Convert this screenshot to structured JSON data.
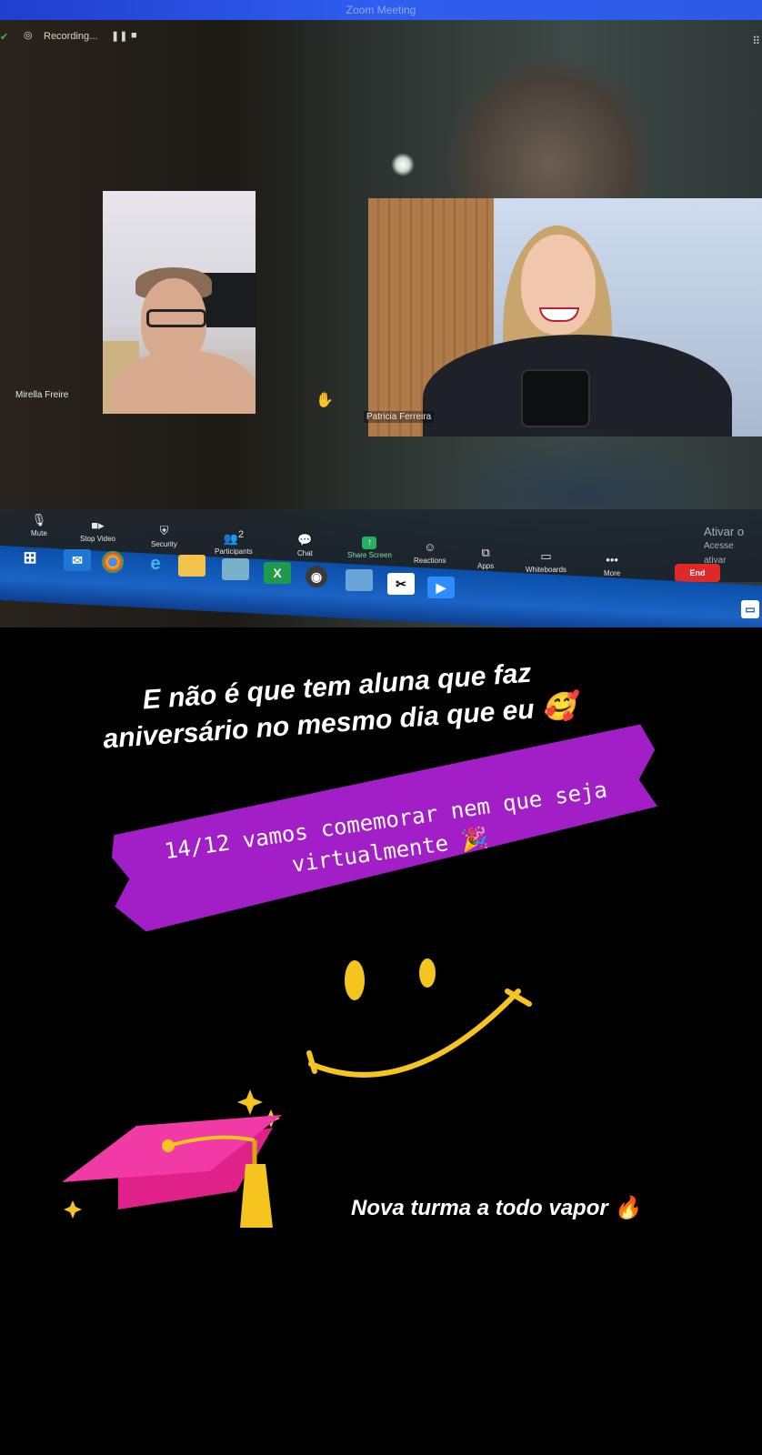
{
  "window": {
    "title": "Zoom Meeting"
  },
  "recording": {
    "status": "Recording...",
    "pause_symbol": "❚❚",
    "stop_symbol": "■"
  },
  "participants": [
    {
      "name": "Mirella Freire"
    },
    {
      "name": "Patricia Ferreira"
    }
  ],
  "toolbar": {
    "mute": "Mute",
    "stop_video": "Stop Video",
    "security": "Security",
    "participants": "Participants",
    "participants_count": "2",
    "chat": "Chat",
    "share_screen": "Share Screen",
    "reactions": "Reactions",
    "apps": "Apps",
    "whiteboards": "Whiteboards",
    "more": "More",
    "end": "End"
  },
  "watermark": {
    "line1": "Ativar o",
    "line2": "Acesse",
    "line3": "ativar"
  },
  "story": {
    "caption1_line1": "E não é que tem aluna que faz",
    "caption1_line2": "aniversário no mesmo dia que eu 🥰",
    "caption2_line1": "14/12 vamos comemorar nem que seja",
    "caption2_line2": "virtualmente 🎉",
    "caption3": "Nova turma a todo vapor 🔥"
  },
  "colors": {
    "zoom_blue": "#2d8cff",
    "end_red": "#e02828",
    "brush_purple": "#a21ec7",
    "cap_pink": "#f13aa6",
    "smiley_yellow": "#f5c41f"
  },
  "icons": [
    "microphone-icon",
    "video-camera-icon",
    "shield-icon",
    "participants-icon",
    "chat-icon",
    "share-screen-icon",
    "reactions-icon",
    "apps-icon",
    "whiteboard-icon",
    "more-icon",
    "raised-hand-icon",
    "smiley-drawing",
    "graduation-cap-drawing"
  ]
}
